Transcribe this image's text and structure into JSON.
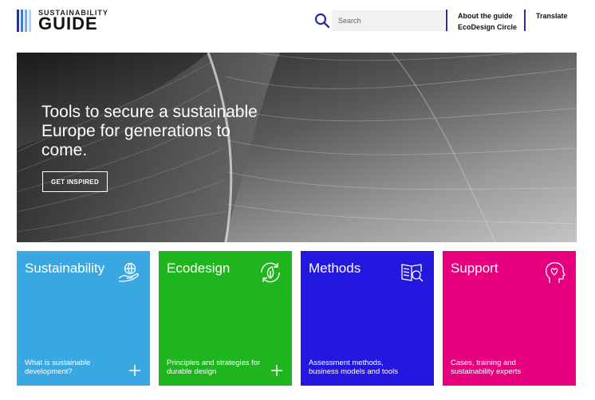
{
  "logo": {
    "top_text": "SUSTAINABILITY",
    "main_text": "GUIDE",
    "bar_colors": [
      "#2b2bb0",
      "#3a7bd5",
      "#7aaee8",
      "#b8d3f2"
    ]
  },
  "header": {
    "search_placeholder": "Search",
    "about_link": "About the guide",
    "ecodesign_link": "EcoDesign Circle",
    "translate_link": "Translate"
  },
  "hero": {
    "title": "Tools to secure a sustainable Europe for generations to come.",
    "button_label": "GET INSPIRED"
  },
  "cards": [
    {
      "title": "Sustainability",
      "description": "What is sustainable development?",
      "color": "#3aa8e0",
      "icon": "hand-globe-icon",
      "has_plus": true
    },
    {
      "title": "Ecodesign",
      "description": "Principles and strategies for durable design",
      "color": "#1fb51f",
      "icon": "leaf-cycle-icon",
      "has_plus": true
    },
    {
      "title": "Methods",
      "description": "Assessment methods, business models and tools",
      "color": "#2417df",
      "icon": "book-magnifier-icon",
      "has_plus": false
    },
    {
      "title": "Support",
      "description": "Cases, training and sustainability experts",
      "color": "#e6007e",
      "icon": "head-heart-icon",
      "has_plus": false
    }
  ],
  "colors": {
    "accent": "#2b2bb0"
  }
}
